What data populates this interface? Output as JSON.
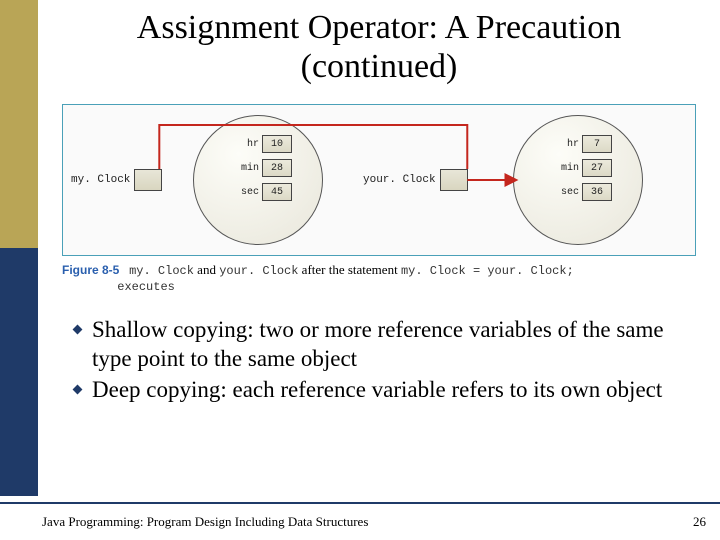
{
  "title_line1": "Assignment Operator: A Precaution",
  "title_line2": "(continued)",
  "vars": {
    "left": "my. Clock",
    "right": "your. Clock"
  },
  "obj1": {
    "fields": [
      "hr",
      "min",
      "sec"
    ],
    "values": [
      "10",
      "28",
      "45"
    ]
  },
  "obj2": {
    "fields": [
      "hr",
      "min",
      "sec"
    ],
    "values": [
      "7",
      "27",
      "36"
    ]
  },
  "figure": {
    "label": "Figure 8-5",
    "code_a": "my. Clock",
    "text_a": " and ",
    "code_b": "your. Clock",
    "text_b": " after the statement ",
    "code_c": "my. Clock = your. Clock;",
    "text_c": "executes"
  },
  "bullets": [
    "Shallow copying: two or more reference variables of the same type point to the same object",
    "Deep copying: each reference variable refers to its own object"
  ],
  "footer": {
    "text": "Java Programming: Program Design Including Data Structures",
    "page": "26"
  }
}
